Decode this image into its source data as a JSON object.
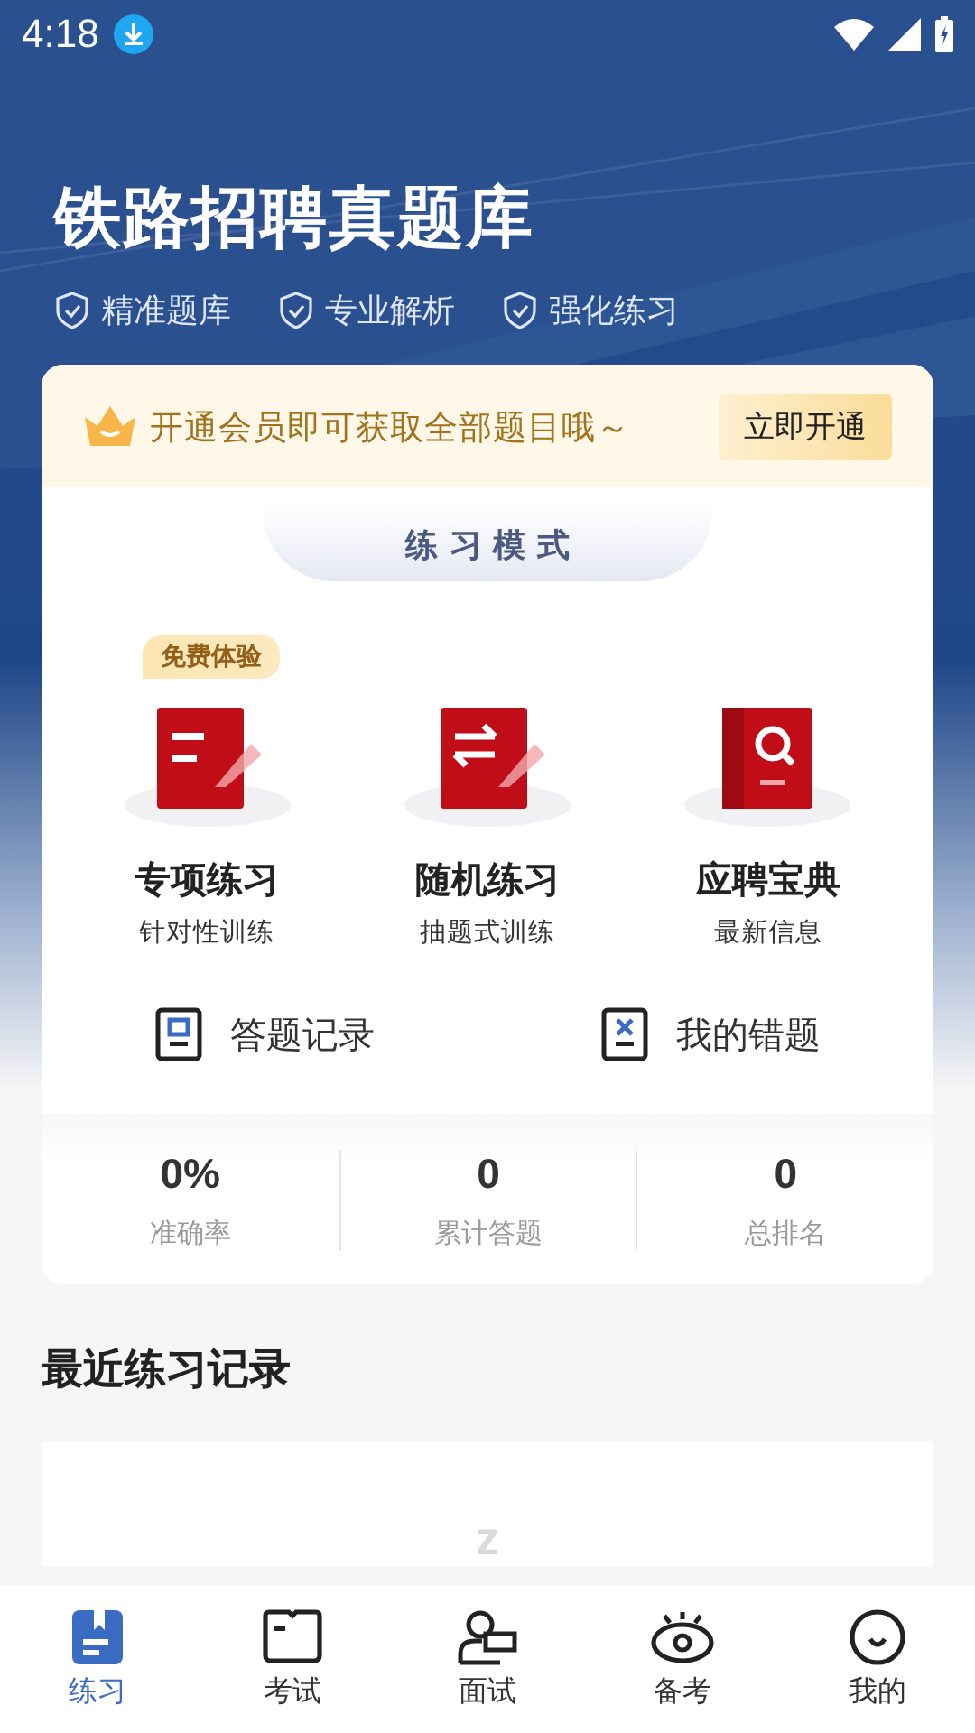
{
  "status_bar": {
    "time": "4:18"
  },
  "header": {
    "title": "铁路招聘真题库",
    "features": [
      "精准题库",
      "专业解析",
      "强化练习"
    ]
  },
  "promo": {
    "text": "开通会员即可获取全部题目哦～",
    "button": "立即开通"
  },
  "practice_mode": {
    "title": "练 习 模 式",
    "modes": [
      {
        "kind": "topic",
        "title": "专项练习",
        "subtitle": "针对性训练",
        "badge": "免费体验"
      },
      {
        "kind": "random",
        "title": "随机练习",
        "subtitle": "抽题式训练"
      },
      {
        "kind": "guide",
        "title": "应聘宝典",
        "subtitle": "最新信息"
      }
    ]
  },
  "records": [
    {
      "kind": "history",
      "label": "答题记录"
    },
    {
      "kind": "mistakes",
      "label": "我的错题"
    }
  ],
  "stats": [
    {
      "value": "0%",
      "label": "准确率"
    },
    {
      "value": "0",
      "label": "累计答题"
    },
    {
      "value": "0",
      "label": "总排名"
    }
  ],
  "recent": {
    "title": "最近练习记录",
    "empty_mark": "z"
  },
  "tab_bar": [
    {
      "kind": "practice",
      "label": "练习",
      "selected": true
    },
    {
      "kind": "exam",
      "label": "考试",
      "selected": false
    },
    {
      "kind": "interview",
      "label": "面试",
      "selected": false
    },
    {
      "kind": "prepare",
      "label": "备考",
      "selected": false
    },
    {
      "kind": "profile",
      "label": "我的",
      "selected": false
    }
  ]
}
